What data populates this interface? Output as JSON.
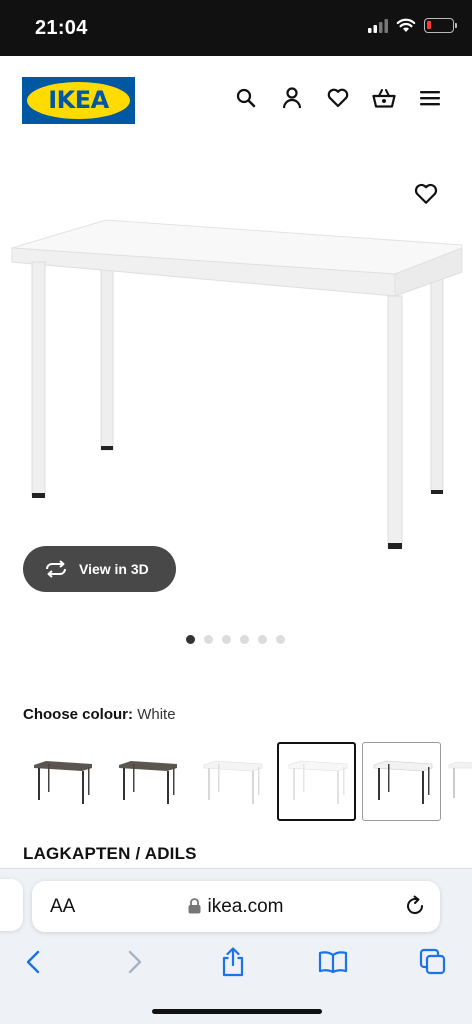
{
  "status_bar": {
    "time": "21:04"
  },
  "header": {
    "logo_text": "IKEA",
    "icons": [
      "search-icon",
      "account-icon",
      "heart-icon",
      "basket-icon",
      "menu-icon"
    ]
  },
  "product": {
    "view_3d_label": "View in 3D",
    "carousel": {
      "total": 6,
      "active": 1
    },
    "choose_colour_label": "Choose colour:",
    "selected_colour": "White",
    "colour_options": [
      {
        "name": "black-brown-grey",
        "top": "#5a5550",
        "legs": "#333333"
      },
      {
        "name": "black-brown-black",
        "top": "#5c5650",
        "legs": "#333333"
      },
      {
        "name": "white-white",
        "top": "#f4f4f4",
        "legs": "#d8d8d8"
      },
      {
        "name": "white",
        "top": "#f7f7f7",
        "legs": "#e2e2e2"
      },
      {
        "name": "white-black",
        "top": "#f2f2f2",
        "legs": "#333333"
      },
      {
        "name": "white-partial",
        "top": "#f2f2f2",
        "legs": "#cccccc"
      }
    ],
    "name": "LAGKAPTEN / ADILS"
  },
  "browser": {
    "aa_label": "AA",
    "url": "ikea.com"
  },
  "colors": {
    "ikea_blue": "#0058a3",
    "ikea_yellow": "#ffdb00",
    "safari_blue": "#1a73e8"
  }
}
